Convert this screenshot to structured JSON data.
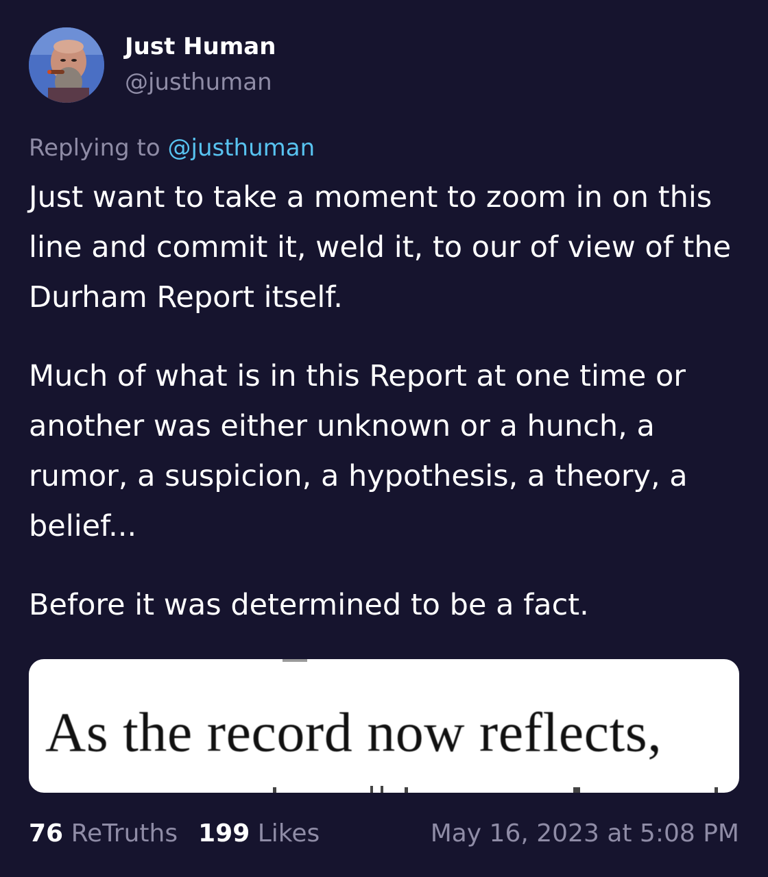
{
  "author": {
    "display_name": "Just Human",
    "handle": "@justhuman"
  },
  "reply": {
    "prefix": "Replying to",
    "mention": "@justhuman"
  },
  "post": {
    "paragraphs": [
      "Just want to take a moment to zoom in on this line and commit it, weld it, to our of view of the Durham Report itself.",
      "Much of what is in this Report at one time or another was either unknown or a hunch, a rumor, a suspicion, a hypothesis, a theory, a belief...",
      "Before it was determined to be a fact."
    ],
    "media_caption": "As the record now reflects,"
  },
  "stats": {
    "retruths_count": "76",
    "retruths_label": "ReTruths",
    "likes_count": "199",
    "likes_label": "Likes",
    "timestamp": "May 16, 2023 at 5:08 PM"
  },
  "colors": {
    "background": "#16142e",
    "muted_text": "#8f8ca6",
    "mention": "#58c3f0"
  }
}
